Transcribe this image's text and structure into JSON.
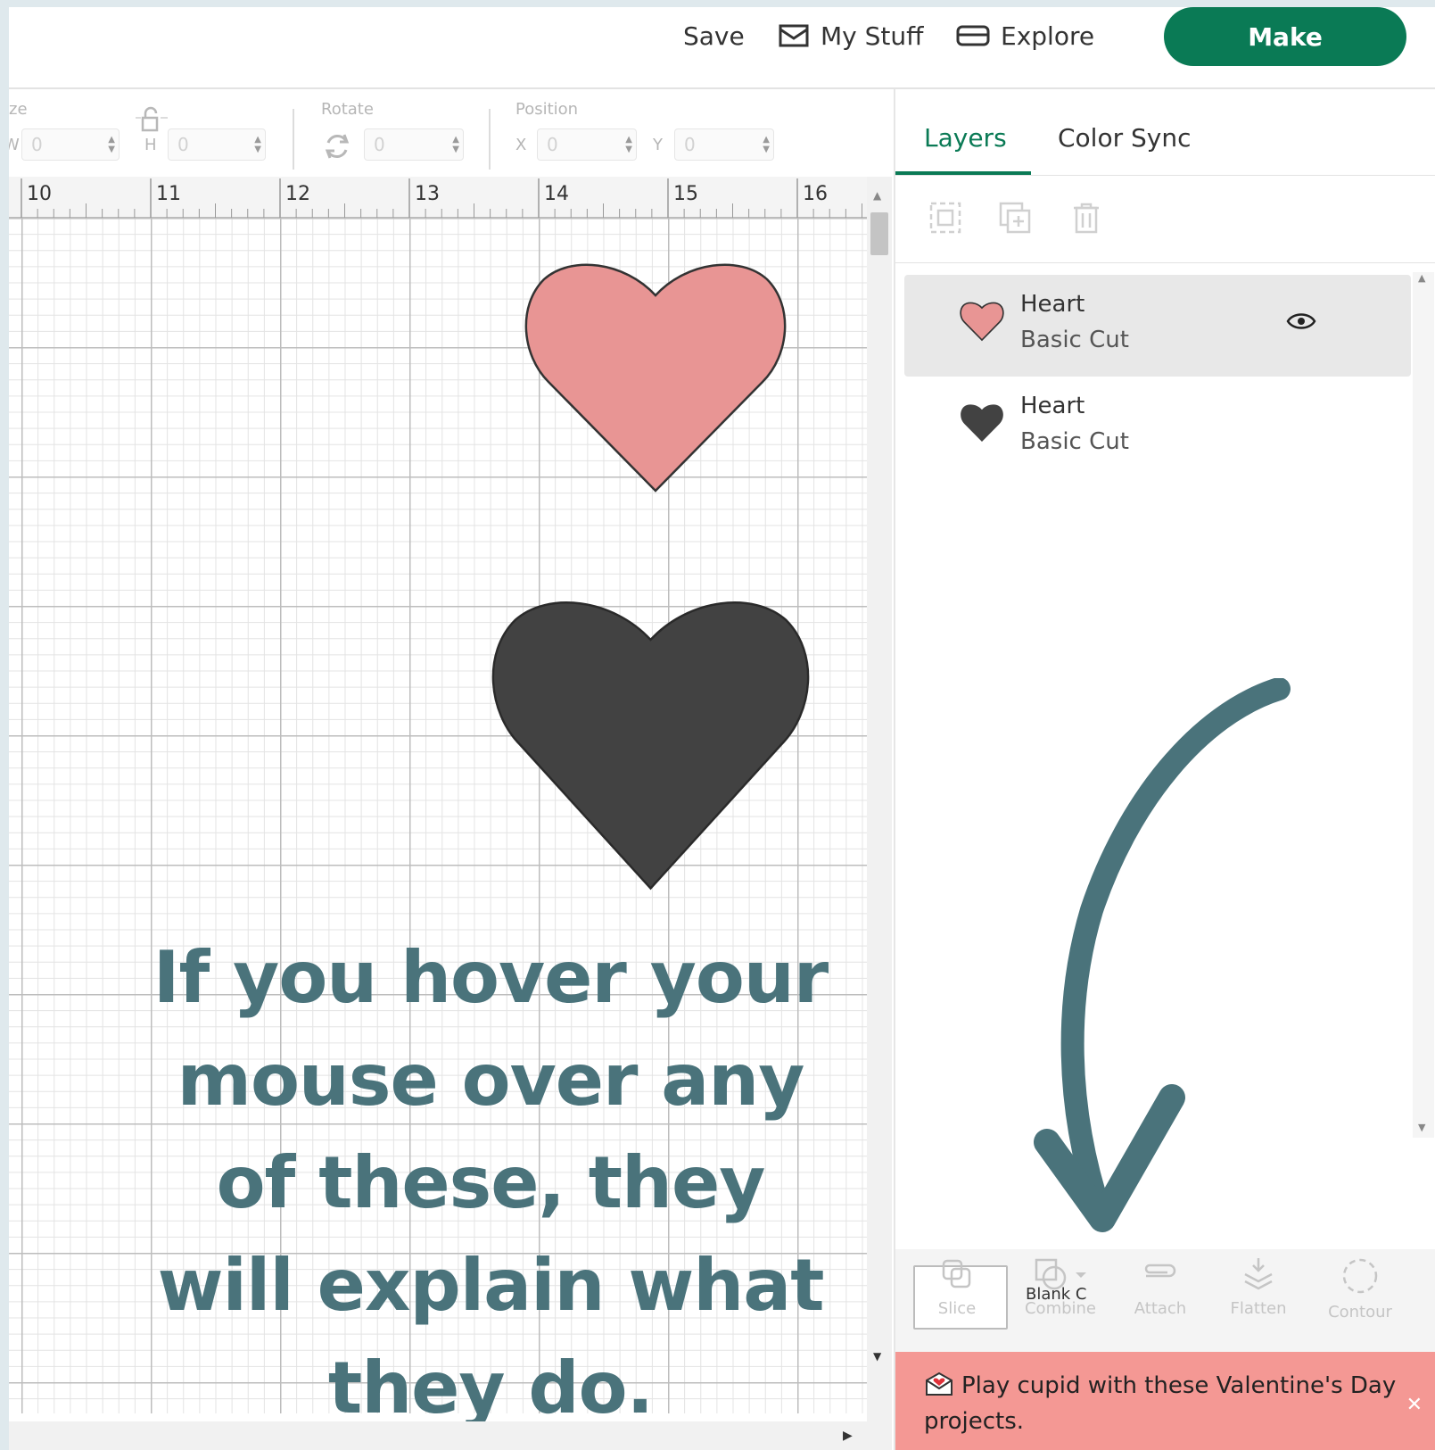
{
  "header": {
    "save_label": "Save",
    "my_stuff_label": "My Stuff",
    "explore_label": "Explore",
    "make_label": "Make"
  },
  "toolbar": {
    "size_label": "ze",
    "w_label": "W",
    "h_label": "H",
    "w_value": "0",
    "h_value": "0",
    "rotate_label": "Rotate",
    "rotate_value": "0",
    "position_label": "Position",
    "x_label": "X",
    "x_value": "0",
    "y_label": "Y",
    "y_value": "0"
  },
  "ruler": {
    "ticks": [
      "10",
      "11",
      "12",
      "13",
      "14",
      "15",
      "16"
    ]
  },
  "canvas": {
    "shapes": [
      {
        "name": "Heart",
        "color": "#e89594"
      },
      {
        "name": "Heart",
        "color": "#424242"
      }
    ]
  },
  "overlay": {
    "text": "If you hover your mouse over any of these, they will explain what they do.",
    "color": "#4a737b"
  },
  "panel": {
    "tabs": [
      "Layers",
      "Color Sync"
    ],
    "active_tab": "Layers",
    "layers": [
      {
        "name": "Heart",
        "operation": "Basic Cut",
        "color": "#e89594",
        "selected": true
      },
      {
        "name": "Heart",
        "operation": "Basic Cut",
        "color": "#424242",
        "selected": false
      }
    ],
    "blank_canvas_label": "Blank C",
    "tools": [
      {
        "label": "Slice",
        "icon": "slice-icon"
      },
      {
        "label": "Combine",
        "icon": "combine-icon"
      },
      {
        "label": "Attach",
        "icon": "attach-icon"
      },
      {
        "label": "Flatten",
        "icon": "flatten-icon"
      },
      {
        "label": "Contour",
        "icon": "contour-icon"
      }
    ],
    "banner_text": "Play cupid with these Valentine's Day projects."
  },
  "colors": {
    "brand_green": "#0a7a55",
    "banner": "#f49894"
  }
}
